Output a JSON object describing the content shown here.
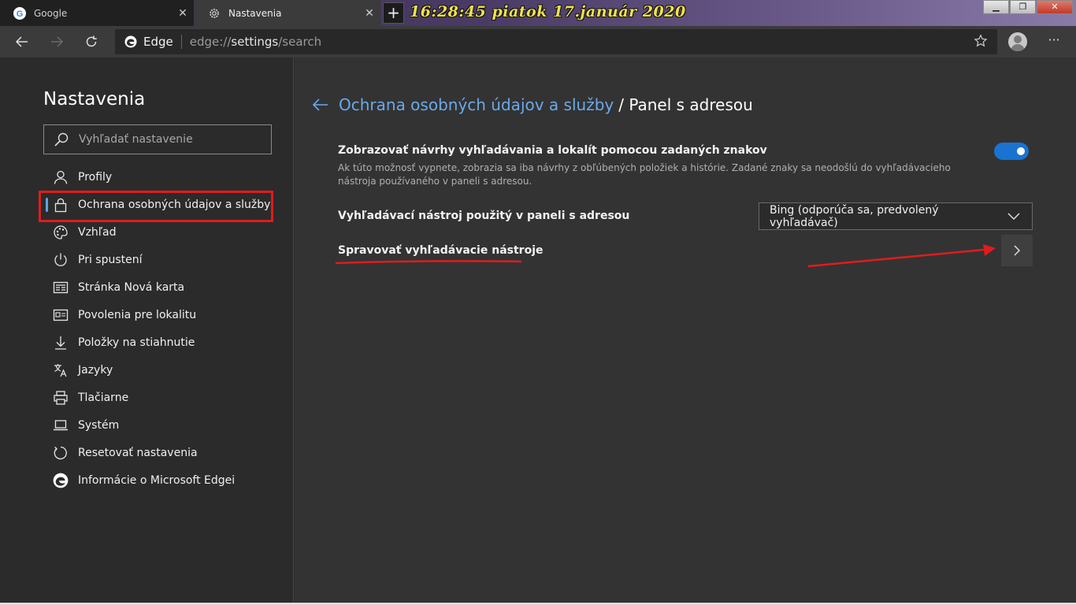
{
  "tabs": [
    {
      "title": "Google",
      "icon": "google-icon"
    },
    {
      "title": "Nastavenia",
      "icon": "gear-icon"
    }
  ],
  "clock": "16:28:45  piatok 17.január 2020",
  "address": {
    "scheme_label": "Edge",
    "url_prefix": "edge://",
    "url_host": "settings",
    "url_path": "/search"
  },
  "sidebar": {
    "title": "Nastavenia",
    "search_placeholder": "Vyhľadať nastavenie",
    "items": [
      {
        "label": "Profily",
        "icon": "person-icon"
      },
      {
        "label": "Ochrana osobných údajov a služby",
        "icon": "lock-icon",
        "selected": true
      },
      {
        "label": "Vzhľad",
        "icon": "palette-icon"
      },
      {
        "label": "Pri spustení",
        "icon": "power-icon"
      },
      {
        "label": "Stránka Nová karta",
        "icon": "newtab-icon"
      },
      {
        "label": "Povolenia pre lokalitu",
        "icon": "site-permissions-icon"
      },
      {
        "label": "Položky na stiahnutie",
        "icon": "download-icon"
      },
      {
        "label": "Jazyky",
        "icon": "language-icon"
      },
      {
        "label": "Tlačiarne",
        "icon": "printer-icon"
      },
      {
        "label": "Systém",
        "icon": "laptop-icon"
      },
      {
        "label": "Resetovať nastavenia",
        "icon": "reset-icon"
      },
      {
        "label": "Informácie o Microsoft Edgei",
        "icon": "edge-icon"
      }
    ]
  },
  "main": {
    "breadcrumb_parent": "Ochrana osobných údajov a služby",
    "breadcrumb_current": "/ Panel s adresou",
    "suggestions_title": "Zobrazovať návrhy vyhľadávania a lokalít pomocou zadaných znakov",
    "suggestions_desc": "Ak túto možnosť vypnete, zobrazia sa iba návrhy z obľúbených položiek a histórie. Zadané znaky sa neodošlú do vyhľadávacieho nástroja používaného v paneli s adresou.",
    "suggestions_enabled": true,
    "engine_label": "Vyhľadávací nástroj použitý v paneli s adresou",
    "engine_value": "Bing (odporúča sa, predvolený vyhľadávač)",
    "manage_label": "Spravovať vyhľadávacie nástroje"
  },
  "colors": {
    "accent": "#1a73d0",
    "link": "#6aa9ea",
    "annotation": "#e21b1b"
  }
}
